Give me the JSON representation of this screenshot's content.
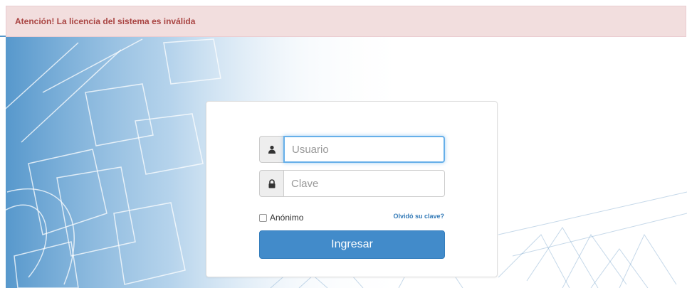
{
  "alert": {
    "message": "Atención! La licencia del sistema es inválida"
  },
  "login": {
    "username": {
      "placeholder": "Usuario",
      "value": "",
      "icon": "user-icon"
    },
    "password": {
      "placeholder": "Clave",
      "value": "",
      "icon": "lock-icon"
    },
    "remember_label": "Anónimo",
    "remember_checked": false,
    "forgot_label": "Olvidó su clave?",
    "submit_label": "Ingresar"
  },
  "colors": {
    "alert_bg": "#f2dede",
    "alert_text": "#a94442",
    "primary": "#428bca",
    "link": "#337ab7",
    "focus": "#66afe9"
  }
}
